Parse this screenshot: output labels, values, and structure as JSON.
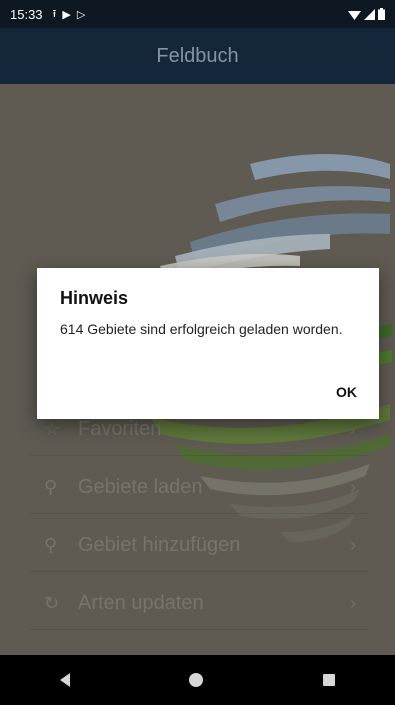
{
  "status_bar": {
    "time": "15:33",
    "icons": [
      "upload-icon",
      "play-store-icon",
      "play-icon",
      "wifi-icon",
      "signal-icon",
      "battery-icon"
    ]
  },
  "app_bar": {
    "title": "Feldbuch"
  },
  "menu": {
    "items": [
      {
        "label": "Favoriten",
        "icon": "star-icon",
        "icon_glyph": "☆"
      },
      {
        "label": "Gebiete laden",
        "icon": "pin-icon",
        "icon_glyph": "⚲"
      },
      {
        "label": "Gebiet hinzufügen",
        "icon": "pin-icon",
        "icon_glyph": "⚲"
      },
      {
        "label": "Arten updaten",
        "icon": "refresh-icon",
        "icon_glyph": "↻"
      }
    ],
    "chevron": "›"
  },
  "dialog": {
    "title": "Hinweis",
    "message": "614 Gebiete sind erfolgreich geladen worden.",
    "ok_label": "OK"
  },
  "colors": {
    "status_bar": "#0d1822",
    "app_bar": "#14273a",
    "dimmed_content": "#5f5b53",
    "dialog_bg": "#ffffff"
  }
}
